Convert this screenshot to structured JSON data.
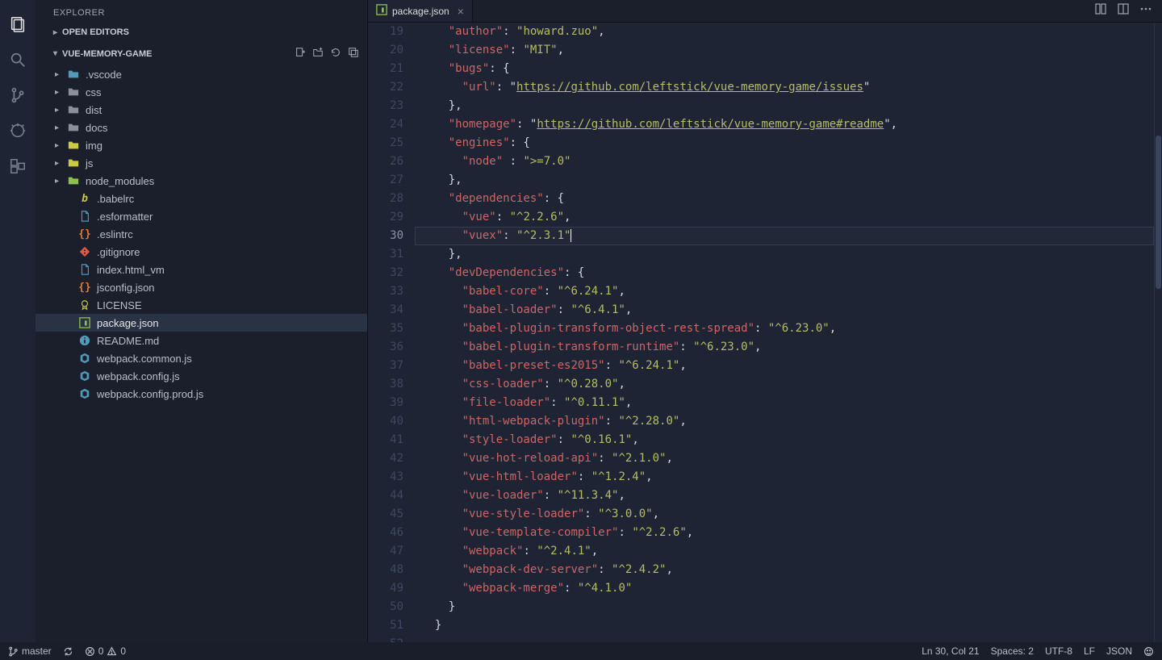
{
  "sidebar": {
    "title": "EXPLORER",
    "openEditors": "OPEN EDITORS",
    "project": "VUE-MEMORY-GAME",
    "tree": [
      {
        "kind": "folder",
        "label": ".vscode",
        "color": "#519aba"
      },
      {
        "kind": "folder",
        "label": "css",
        "color": "#8a8f99"
      },
      {
        "kind": "folder",
        "label": "dist",
        "color": "#8a8f99"
      },
      {
        "kind": "folder",
        "label": "docs",
        "color": "#8a8f99"
      },
      {
        "kind": "folder",
        "label": "img",
        "color": "#cbcb41"
      },
      {
        "kind": "folder",
        "label": "js",
        "color": "#cbcb41"
      },
      {
        "kind": "folder",
        "label": "node_modules",
        "color": "#8dc149"
      },
      {
        "kind": "file",
        "label": ".babelrc",
        "icon": "babel",
        "color": "#cbcb41"
      },
      {
        "kind": "file",
        "label": ".esformatter",
        "icon": "file",
        "color": "#519aba"
      },
      {
        "kind": "file",
        "label": ".eslintrc",
        "icon": "brace",
        "color": "#e37933"
      },
      {
        "kind": "file",
        "label": ".gitignore",
        "icon": "git",
        "color": "#e05a47"
      },
      {
        "kind": "file",
        "label": "index.html_vm",
        "icon": "file",
        "color": "#519aba"
      },
      {
        "kind": "file",
        "label": "jsconfig.json",
        "icon": "brace",
        "color": "#e37933"
      },
      {
        "kind": "file",
        "label": "LICENSE",
        "icon": "cert",
        "color": "#cbcb41"
      },
      {
        "kind": "file",
        "label": "package.json",
        "icon": "npm",
        "color": "#8dc149",
        "selected": true
      },
      {
        "kind": "file",
        "label": "README.md",
        "icon": "info",
        "color": "#519aba"
      },
      {
        "kind": "file",
        "label": "webpack.common.js",
        "icon": "webpack",
        "color": "#519aba"
      },
      {
        "kind": "file",
        "label": "webpack.config.js",
        "icon": "webpack",
        "color": "#519aba"
      },
      {
        "kind": "file",
        "label": "webpack.config.prod.js",
        "icon": "webpack",
        "color": "#519aba"
      }
    ]
  },
  "tab": {
    "label": "package.json"
  },
  "code": {
    "startLine": 19,
    "activeLine": 30,
    "lines": [
      {
        "indent": 2,
        "segs": [
          {
            "k": "key",
            "t": "\"author\""
          },
          {
            "k": "punc",
            "t": ": "
          },
          {
            "k": "str",
            "t": "\"howard.zuo\""
          },
          {
            "k": "punc",
            "t": ","
          }
        ]
      },
      {
        "indent": 2,
        "segs": [
          {
            "k": "key",
            "t": "\"license\""
          },
          {
            "k": "punc",
            "t": ": "
          },
          {
            "k": "str",
            "t": "\"MIT\""
          },
          {
            "k": "punc",
            "t": ","
          }
        ]
      },
      {
        "indent": 2,
        "segs": [
          {
            "k": "key",
            "t": "\"bugs\""
          },
          {
            "k": "punc",
            "t": ": {"
          }
        ]
      },
      {
        "indent": 3,
        "segs": [
          {
            "k": "key",
            "t": "\"url\""
          },
          {
            "k": "punc",
            "t": ": "
          },
          {
            "k": "punc",
            "t": "\""
          },
          {
            "k": "link",
            "t": "https://github.com/leftstick/vue-memory-game/issues"
          },
          {
            "k": "punc",
            "t": "\""
          }
        ]
      },
      {
        "indent": 2,
        "segs": [
          {
            "k": "punc",
            "t": "},"
          }
        ]
      },
      {
        "indent": 2,
        "segs": [
          {
            "k": "key",
            "t": "\"homepage\""
          },
          {
            "k": "punc",
            "t": ": "
          },
          {
            "k": "punc",
            "t": "\""
          },
          {
            "k": "link",
            "t": "https://github.com/leftstick/vue-memory-game#readme"
          },
          {
            "k": "punc",
            "t": "\""
          },
          {
            "k": "punc",
            "t": ","
          }
        ]
      },
      {
        "indent": 2,
        "segs": [
          {
            "k": "key",
            "t": "\"engines\""
          },
          {
            "k": "punc",
            "t": ": {"
          }
        ]
      },
      {
        "indent": 3,
        "segs": [
          {
            "k": "key",
            "t": "\"node\""
          },
          {
            "k": "punc",
            "t": " : "
          },
          {
            "k": "str",
            "t": "\">=7.0\""
          }
        ]
      },
      {
        "indent": 2,
        "segs": [
          {
            "k": "punc",
            "t": "},"
          }
        ]
      },
      {
        "indent": 2,
        "segs": [
          {
            "k": "key",
            "t": "\"dependencies\""
          },
          {
            "k": "punc",
            "t": ": {"
          }
        ]
      },
      {
        "indent": 3,
        "segs": [
          {
            "k": "key",
            "t": "\"vue\""
          },
          {
            "k": "punc",
            "t": ": "
          },
          {
            "k": "str",
            "t": "\"^2.2.6\""
          },
          {
            "k": "punc",
            "t": ","
          }
        ]
      },
      {
        "indent": 3,
        "segs": [
          {
            "k": "key",
            "t": "\"vuex\""
          },
          {
            "k": "punc",
            "t": ": "
          },
          {
            "k": "str",
            "t": "\"^2.3.1\""
          }
        ]
      },
      {
        "indent": 2,
        "segs": [
          {
            "k": "punc",
            "t": "},"
          }
        ]
      },
      {
        "indent": 2,
        "segs": [
          {
            "k": "key",
            "t": "\"devDependencies\""
          },
          {
            "k": "punc",
            "t": ": {"
          }
        ]
      },
      {
        "indent": 3,
        "segs": [
          {
            "k": "key",
            "t": "\"babel-core\""
          },
          {
            "k": "punc",
            "t": ": "
          },
          {
            "k": "str",
            "t": "\"^6.24.1\""
          },
          {
            "k": "punc",
            "t": ","
          }
        ]
      },
      {
        "indent": 3,
        "segs": [
          {
            "k": "key",
            "t": "\"babel-loader\""
          },
          {
            "k": "punc",
            "t": ": "
          },
          {
            "k": "str",
            "t": "\"^6.4.1\""
          },
          {
            "k": "punc",
            "t": ","
          }
        ]
      },
      {
        "indent": 3,
        "segs": [
          {
            "k": "key",
            "t": "\"babel-plugin-transform-object-rest-spread\""
          },
          {
            "k": "punc",
            "t": ": "
          },
          {
            "k": "str",
            "t": "\"^6.23.0\""
          },
          {
            "k": "punc",
            "t": ","
          }
        ]
      },
      {
        "indent": 3,
        "segs": [
          {
            "k": "key",
            "t": "\"babel-plugin-transform-runtime\""
          },
          {
            "k": "punc",
            "t": ": "
          },
          {
            "k": "str",
            "t": "\"^6.23.0\""
          },
          {
            "k": "punc",
            "t": ","
          }
        ]
      },
      {
        "indent": 3,
        "segs": [
          {
            "k": "key",
            "t": "\"babel-preset-es2015\""
          },
          {
            "k": "punc",
            "t": ": "
          },
          {
            "k": "str",
            "t": "\"^6.24.1\""
          },
          {
            "k": "punc",
            "t": ","
          }
        ]
      },
      {
        "indent": 3,
        "segs": [
          {
            "k": "key",
            "t": "\"css-loader\""
          },
          {
            "k": "punc",
            "t": ": "
          },
          {
            "k": "str",
            "t": "\"^0.28.0\""
          },
          {
            "k": "punc",
            "t": ","
          }
        ]
      },
      {
        "indent": 3,
        "segs": [
          {
            "k": "key",
            "t": "\"file-loader\""
          },
          {
            "k": "punc",
            "t": ": "
          },
          {
            "k": "str",
            "t": "\"^0.11.1\""
          },
          {
            "k": "punc",
            "t": ","
          }
        ]
      },
      {
        "indent": 3,
        "segs": [
          {
            "k": "key",
            "t": "\"html-webpack-plugin\""
          },
          {
            "k": "punc",
            "t": ": "
          },
          {
            "k": "str",
            "t": "\"^2.28.0\""
          },
          {
            "k": "punc",
            "t": ","
          }
        ]
      },
      {
        "indent": 3,
        "segs": [
          {
            "k": "key",
            "t": "\"style-loader\""
          },
          {
            "k": "punc",
            "t": ": "
          },
          {
            "k": "str",
            "t": "\"^0.16.1\""
          },
          {
            "k": "punc",
            "t": ","
          }
        ]
      },
      {
        "indent": 3,
        "segs": [
          {
            "k": "key",
            "t": "\"vue-hot-reload-api\""
          },
          {
            "k": "punc",
            "t": ": "
          },
          {
            "k": "str",
            "t": "\"^2.1.0\""
          },
          {
            "k": "punc",
            "t": ","
          }
        ]
      },
      {
        "indent": 3,
        "segs": [
          {
            "k": "key",
            "t": "\"vue-html-loader\""
          },
          {
            "k": "punc",
            "t": ": "
          },
          {
            "k": "str",
            "t": "\"^1.2.4\""
          },
          {
            "k": "punc",
            "t": ","
          }
        ]
      },
      {
        "indent": 3,
        "segs": [
          {
            "k": "key",
            "t": "\"vue-loader\""
          },
          {
            "k": "punc",
            "t": ": "
          },
          {
            "k": "str",
            "t": "\"^11.3.4\""
          },
          {
            "k": "punc",
            "t": ","
          }
        ]
      },
      {
        "indent": 3,
        "segs": [
          {
            "k": "key",
            "t": "\"vue-style-loader\""
          },
          {
            "k": "punc",
            "t": ": "
          },
          {
            "k": "str",
            "t": "\"^3.0.0\""
          },
          {
            "k": "punc",
            "t": ","
          }
        ]
      },
      {
        "indent": 3,
        "segs": [
          {
            "k": "key",
            "t": "\"vue-template-compiler\""
          },
          {
            "k": "punc",
            "t": ": "
          },
          {
            "k": "str",
            "t": "\"^2.2.6\""
          },
          {
            "k": "punc",
            "t": ","
          }
        ]
      },
      {
        "indent": 3,
        "segs": [
          {
            "k": "key",
            "t": "\"webpack\""
          },
          {
            "k": "punc",
            "t": ": "
          },
          {
            "k": "str",
            "t": "\"^2.4.1\""
          },
          {
            "k": "punc",
            "t": ","
          }
        ]
      },
      {
        "indent": 3,
        "segs": [
          {
            "k": "key",
            "t": "\"webpack-dev-server\""
          },
          {
            "k": "punc",
            "t": ": "
          },
          {
            "k": "str",
            "t": "\"^2.4.2\""
          },
          {
            "k": "punc",
            "t": ","
          }
        ]
      },
      {
        "indent": 3,
        "segs": [
          {
            "k": "key",
            "t": "\"webpack-merge\""
          },
          {
            "k": "punc",
            "t": ": "
          },
          {
            "k": "str",
            "t": "\"^4.1.0\""
          }
        ]
      },
      {
        "indent": 2,
        "segs": [
          {
            "k": "punc",
            "t": "}"
          }
        ]
      },
      {
        "indent": 1,
        "segs": [
          {
            "k": "punc",
            "t": "}"
          }
        ]
      },
      {
        "indent": 0,
        "segs": []
      }
    ]
  },
  "status": {
    "branch": "master",
    "errors": "0",
    "warnings": "0",
    "position": "Ln 30, Col 21",
    "spaces": "Spaces: 2",
    "encoding": "UTF-8",
    "eol": "LF",
    "language": "JSON"
  }
}
